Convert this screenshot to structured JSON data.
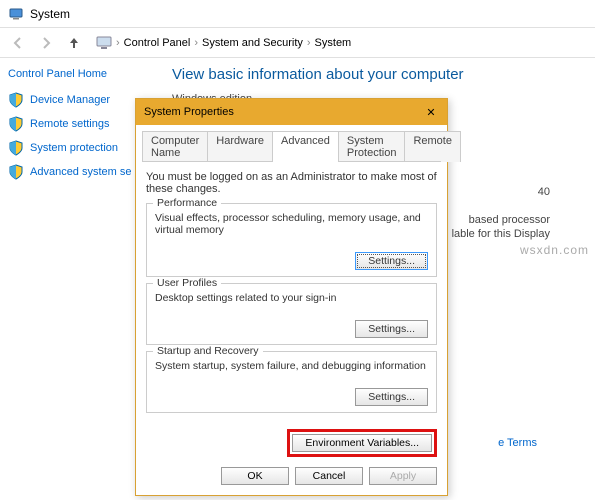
{
  "window": {
    "title": "System"
  },
  "breadcrumb": {
    "c1": "Control Panel",
    "c2": "System and Security",
    "c3": "System"
  },
  "sidebar": {
    "home": "Control Panel Home",
    "items": [
      {
        "label": "Device Manager"
      },
      {
        "label": "Remote settings"
      },
      {
        "label": "System protection"
      },
      {
        "label": "Advanced system se"
      }
    ]
  },
  "main": {
    "header": "View basic information about your computer",
    "section": "Windows edition"
  },
  "peek": {
    "l1": "40",
    "l2": "based processor",
    "l3": "lable for this Display",
    "link": "e Terms"
  },
  "dialog": {
    "title": "System Properties",
    "tabs": {
      "t0": "Computer Name",
      "t1": "Hardware",
      "t2": "Advanced",
      "t3": "System Protection",
      "t4": "Remote"
    },
    "intro": "You must be logged on as an Administrator to make most of these changes.",
    "groups": {
      "perf": {
        "title": "Performance",
        "desc": "Visual effects, processor scheduling, memory usage, and virtual memory",
        "btn": "Settings..."
      },
      "prof": {
        "title": "User Profiles",
        "desc": "Desktop settings related to your sign-in",
        "btn": "Settings..."
      },
      "start": {
        "title": "Startup and Recovery",
        "desc": "System startup, system failure, and debugging information",
        "btn": "Settings..."
      }
    },
    "env": "Environment Variables...",
    "footer": {
      "ok": "OK",
      "cancel": "Cancel",
      "apply": "Apply"
    }
  },
  "watermark": "wsxdn.com"
}
